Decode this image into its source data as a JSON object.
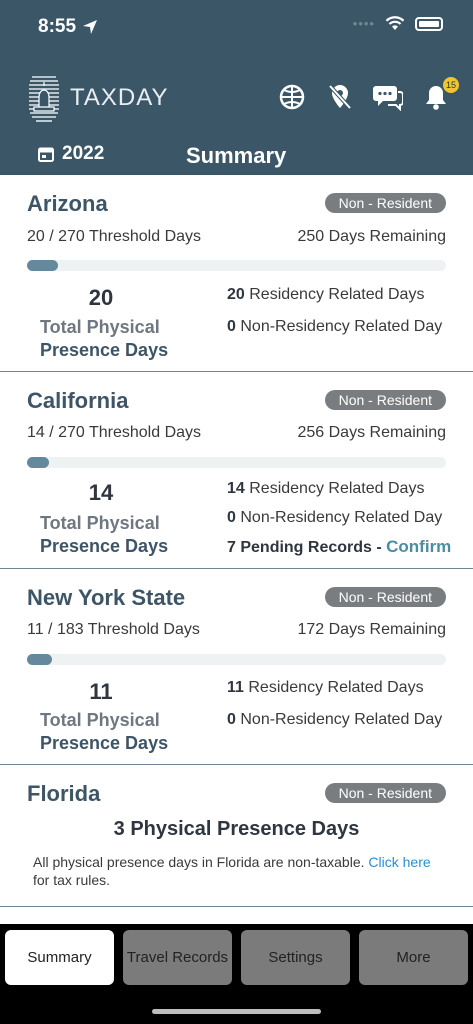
{
  "status": {
    "time": "8:55"
  },
  "header": {
    "logo_text": "TAXDAY",
    "year": "2022",
    "title": "Summary",
    "notification_count": "15"
  },
  "cards": [
    {
      "state": "Arizona",
      "status": "Non - Resident",
      "threshold": "20 / 270 Threshold Days",
      "remaining": "250 Days Remaining",
      "progress": 0.074,
      "total_days": "20",
      "total_label_1": "Total Physical",
      "total_label_2": "Presence Days",
      "residency_count": "20",
      "residency_label": "Residency Related Days",
      "non_residency_count": "0",
      "non_residency_label": "Non-Residency Related Day"
    },
    {
      "state": "California",
      "status": "Non - Resident",
      "threshold": "14 / 270 Threshold Days",
      "remaining": "256 Days Remaining",
      "progress": 0.052,
      "total_days": "14",
      "total_label_1": "Total Physical",
      "total_label_2": "Presence Days",
      "residency_count": "14",
      "residency_label": "Residency Related Days",
      "non_residency_count": "0",
      "non_residency_label": "Non-Residency Related Day",
      "pending_text": "7 Pending Records - ",
      "confirm_label": "Confirm"
    },
    {
      "state": "New York State",
      "status": "Non - Resident",
      "threshold": "11 / 183 Threshold Days",
      "remaining": "172 Days Remaining",
      "progress": 0.06,
      "total_days": "11",
      "total_label_1": "Total Physical",
      "total_label_2": "Presence Days",
      "residency_count": "11",
      "residency_label": "Residency Related Days",
      "non_residency_count": "0",
      "non_residency_label": "Non-Residency Related Day"
    }
  ],
  "florida": {
    "state": "Florida",
    "status": "Non - Resident",
    "days": "3",
    "days_label": "Physical Presence Days",
    "note": "All physical presence days in Florida are non-taxable. ",
    "link": "Click here",
    "note_end": "for tax rules."
  },
  "tabs": [
    {
      "label": "Summary",
      "active": true
    },
    {
      "label": "Travel Records",
      "active": false
    },
    {
      "label": "Settings",
      "active": false
    },
    {
      "label": "More",
      "active": false
    }
  ]
}
